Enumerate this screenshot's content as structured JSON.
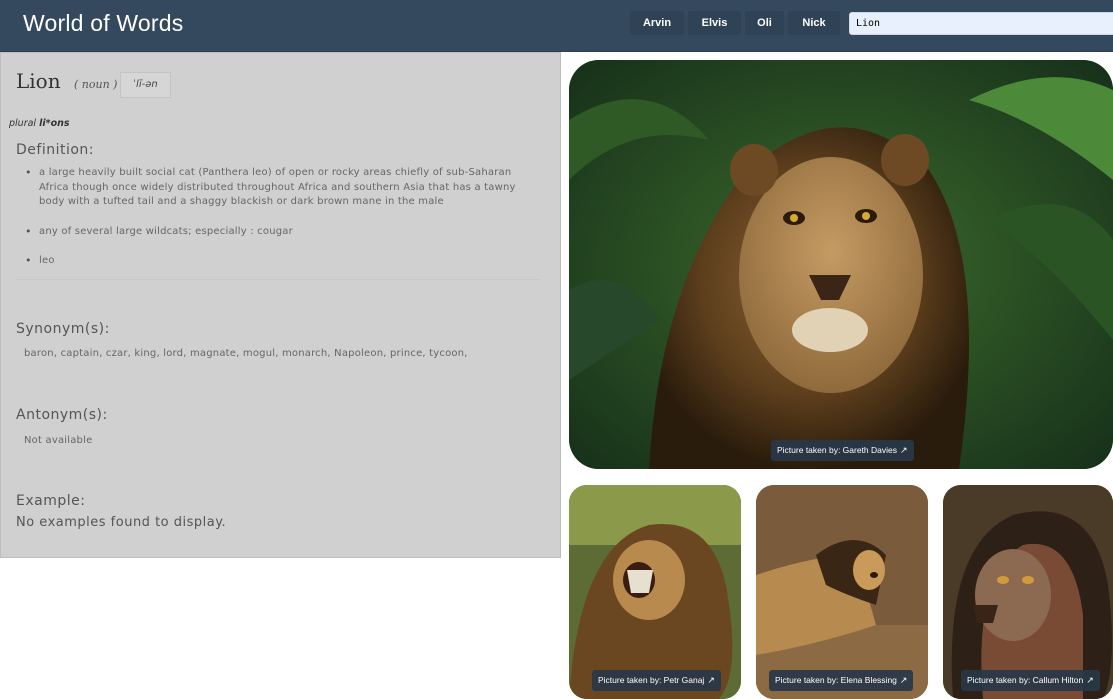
{
  "header": {
    "brand": "World of Words",
    "nav": [
      "Arvin",
      "Elvis",
      "Oli",
      "Nick"
    ],
    "search_value": "Lion"
  },
  "entry": {
    "word": "Lion",
    "part_of_speech": "( noun )",
    "pronunciation": "ˈlī-ən",
    "plural_prefix": "plural",
    "plural_form": "li*ons",
    "definition_heading": "Definition:",
    "definitions": [
      "a large heavily built social cat (Panthera leo) of open or rocky areas chiefly of sub-Saharan Africa though once widely distributed throughout Africa and southern Asia that has a tawny body with a tufted tail and a shaggy blackish or dark brown mane in the male",
      "any of several large wildcats; especially : cougar",
      "leo"
    ],
    "synonyms_heading": "Synonym(s):",
    "synonyms": "baron, captain, czar, king, lord, magnate, mogul, monarch, Napoleon, prince, tycoon,",
    "antonyms_heading": "Antonym(s):",
    "antonyms": "Not available",
    "example_heading": "Example:",
    "example": "No examples found to display."
  },
  "images": {
    "main_credit": "Picture taken by: Gareth Davies",
    "thumb_credits": [
      "Picture taken by: Petr Ganaj",
      "Picture taken by: Elena Blessing",
      "Picture taken by: Callum Hilton"
    ],
    "external_link_icon": "external-link-icon"
  }
}
